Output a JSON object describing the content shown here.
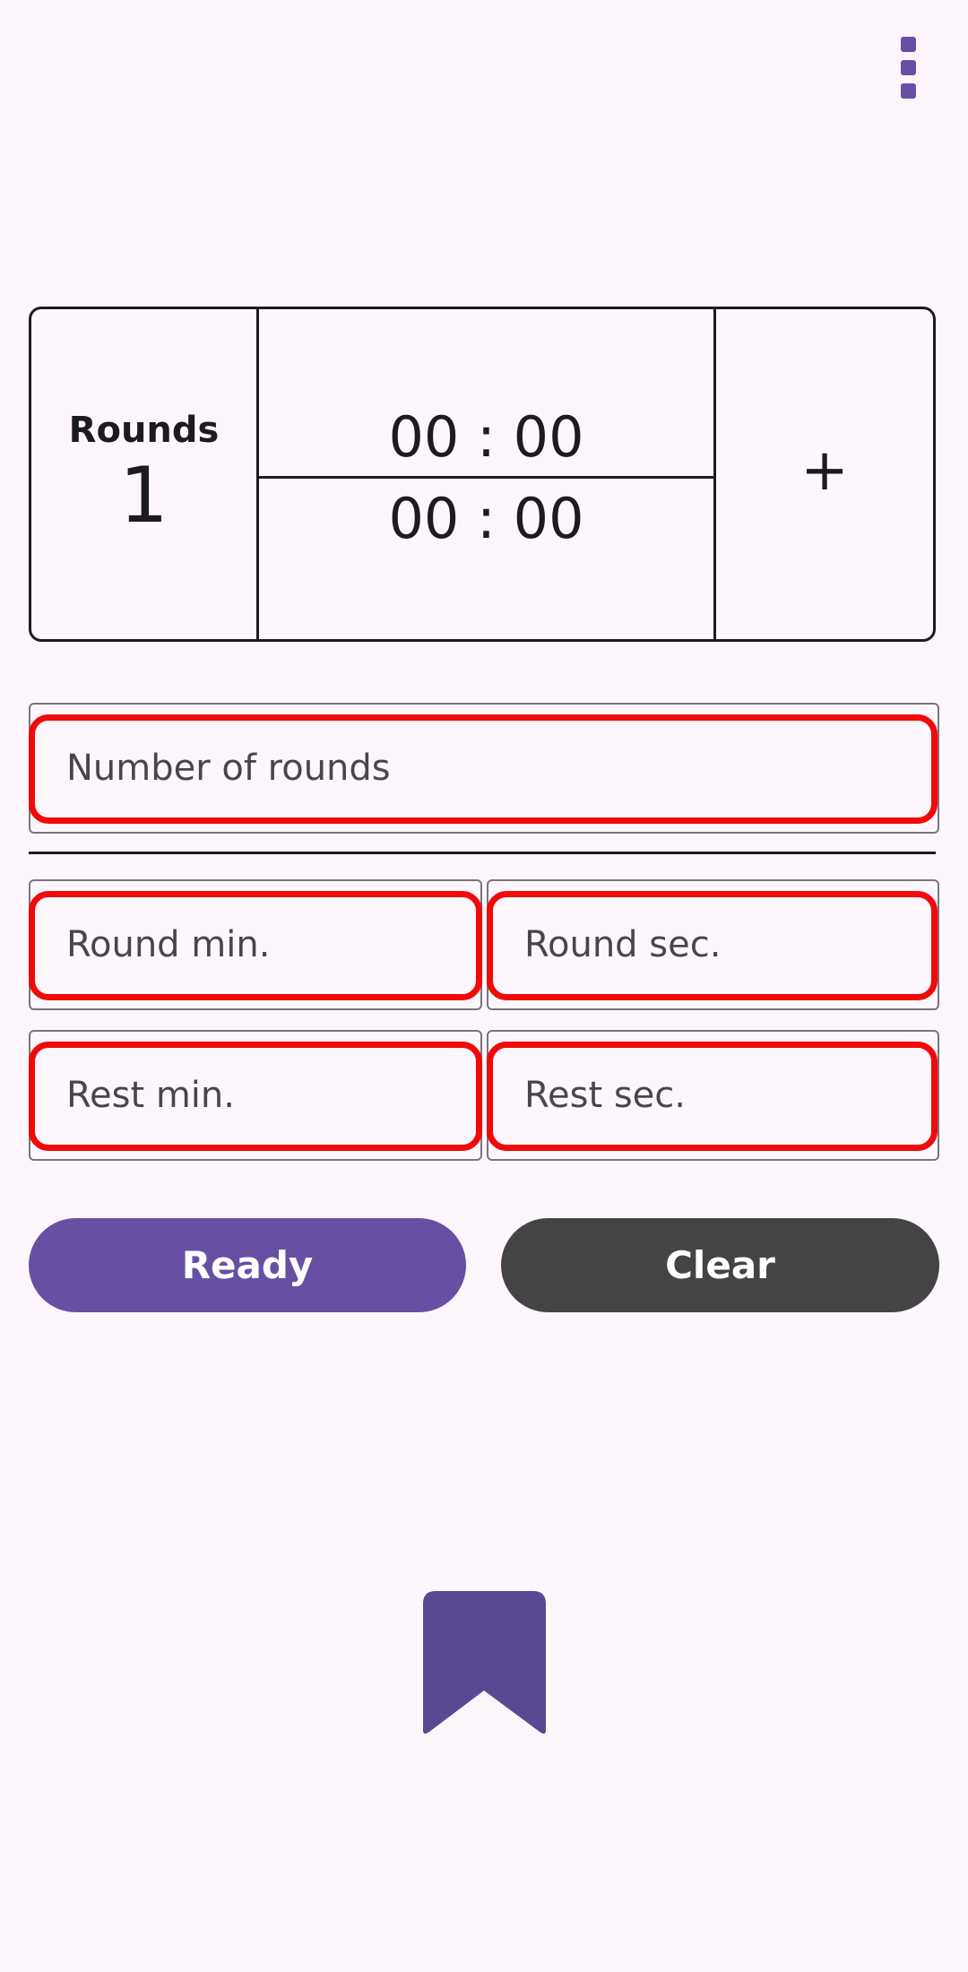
{
  "toolbar": {
    "menu_icon": "more-vert-icon"
  },
  "summary": {
    "rounds_label": "Rounds",
    "rounds_value": "1",
    "round_time": "00 : 00",
    "rest_time": "00 : 00",
    "add_label": "+"
  },
  "form": {
    "rounds_placeholder": "Number of rounds",
    "round_min_placeholder": "Round min.",
    "round_sec_placeholder": "Round sec.",
    "rest_min_placeholder": "Rest min.",
    "rest_sec_placeholder": "Rest sec."
  },
  "actions": {
    "ready_label": "Ready",
    "clear_label": "Clear"
  },
  "colors": {
    "accent": "#6750a4",
    "clear_button": "#444444",
    "highlight": "#f00a0a",
    "background": "#fdf7fd",
    "bookmark": "#5b4892"
  },
  "footer": {
    "icon": "bookmark-icon"
  }
}
